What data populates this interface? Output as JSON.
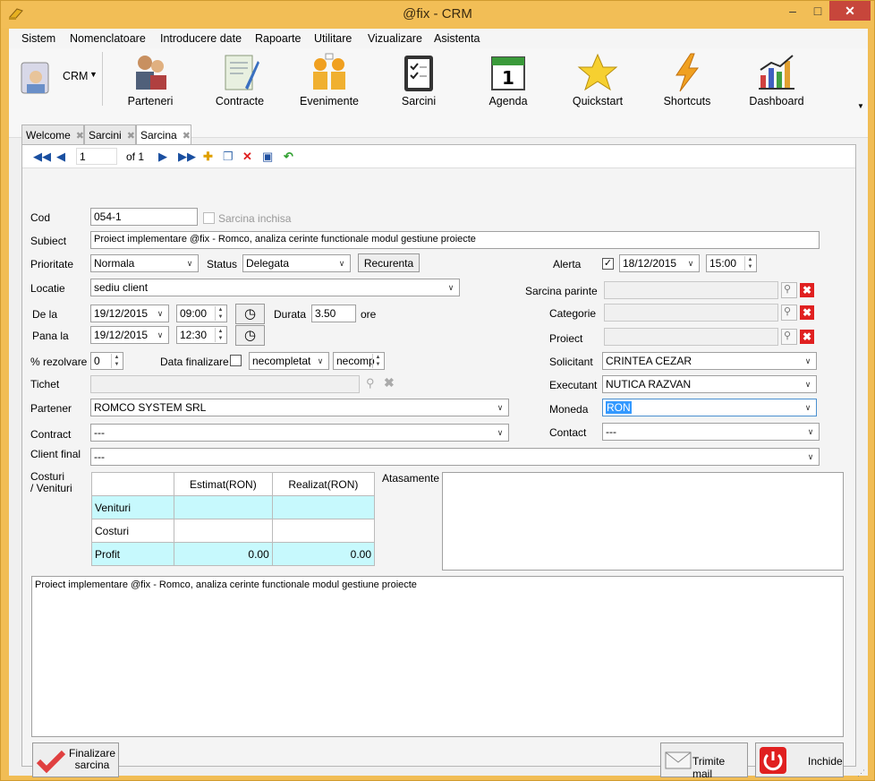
{
  "window": {
    "title": "@fix - CRM"
  },
  "menu": [
    "Sistem",
    "Nomenclatoare",
    "Introducere date",
    "Rapoarte",
    "Utilitare",
    "Vizualizare",
    "Asistenta"
  ],
  "ribbon": {
    "crm_label": "CRM",
    "buttons": [
      "Parteneri",
      "Contracte",
      "Evenimente",
      "Sarcini",
      "Agenda",
      "Quickstart",
      "Shortcuts",
      "Dashboard"
    ]
  },
  "tabs": [
    "Welcome",
    "Sarcini",
    "Sarcina"
  ],
  "nav": {
    "page": "1",
    "of": "of 1"
  },
  "form": {
    "cod_label": "Cod",
    "cod": "054-1",
    "closed_label": "Sarcina inchisa",
    "subiect_label": "Subiect",
    "subiect": "Proiect implementare @fix - Romco, analiza cerinte functionale modul gestiune proiecte",
    "prioritate_label": "Prioritate",
    "prioritate": "Normala",
    "status_label": "Status",
    "status": "Delegata",
    "recurenta": "Recurenta",
    "alerta_label": "Alerta",
    "alerta_date": "18/12/2015",
    "alerta_time": "15:00",
    "locatie_label": "Locatie",
    "locatie": "sediu client",
    "parinte_label": "Sarcina parinte",
    "dela_label": "De la",
    "dela_date": "19/12/2015",
    "dela_time": "09:00",
    "durata_label": "Durata",
    "durata": "3.50",
    "ore": "ore",
    "categorie_label": "Categorie",
    "panala_label": "Pana la",
    "panala_date": "19/12/2015",
    "panala_time": "12:30",
    "proiect_label": "Proiect",
    "rezolvare_label": "% rezolvare",
    "rezolvare": "0",
    "finalizare_label": "Data finalizare",
    "fin_date": "necompletat",
    "fin_time": "necomp",
    "solicitant_label": "Solicitant",
    "solicitant": "CRINTEA CEZAR",
    "tichet_label": "Tichet",
    "executant_label": "Executant",
    "executant": "NUTICA RAZVAN",
    "partener_label": "Partener",
    "partener": "ROMCO SYSTEM SRL",
    "moneda_label": "Moneda",
    "moneda": "RON",
    "contract_label": "Contract",
    "contract": "---",
    "contact_label": "Contact",
    "contact": "---",
    "clientfinal_label": "Client final",
    "clientfinal": "---",
    "costuri_label": "Costuri\n/ Venituri",
    "atasamente_label": "Atasamente",
    "descriere": "Proiect implementare @fix - Romco, analiza cerinte functionale modul gestiune proiecte"
  },
  "costs": {
    "headers": [
      "",
      "Estimat(RON)",
      "Realizat(RON)"
    ],
    "rows": [
      [
        "Venituri",
        "",
        ""
      ],
      [
        "Costuri",
        "",
        ""
      ],
      [
        "Profit",
        "0.00",
        "0.00"
      ]
    ]
  },
  "buttons": {
    "finalizare": "Finalizare\nsarcina",
    "mail": "Trimite mail",
    "close": "Inchide"
  }
}
